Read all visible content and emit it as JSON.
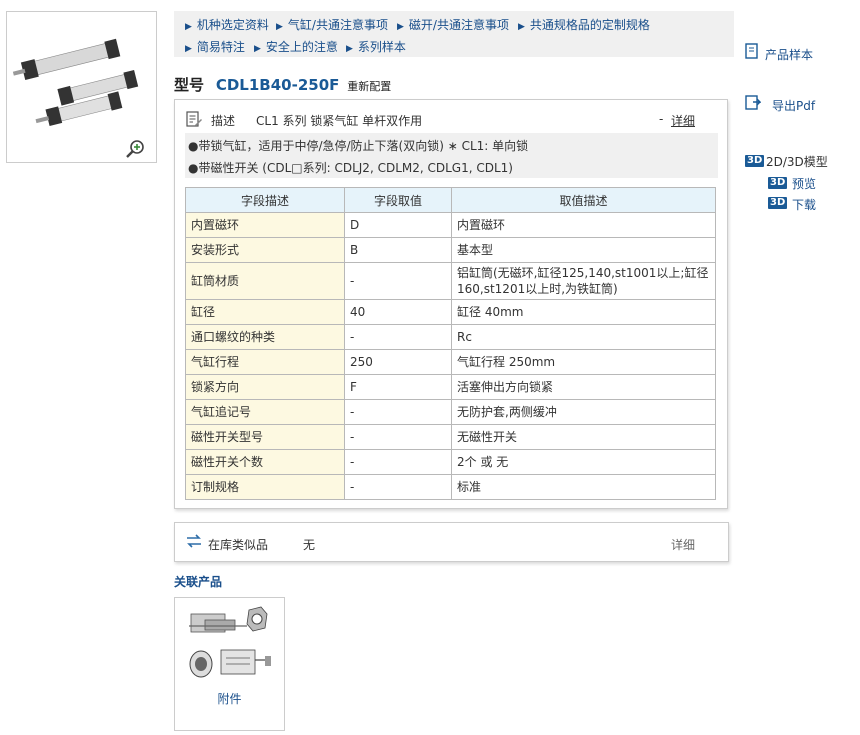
{
  "nav": {
    "row1": [
      "机种选定资料",
      "气缸/共通注意事项",
      "磁开/共通注意事项",
      "共通规格品的定制规格"
    ],
    "row2": [
      "简易特注",
      "安全上的注意",
      "系列样本"
    ]
  },
  "model": {
    "label": "型号",
    "code": "CDL1B40-250F",
    "reconfig": "重新配置"
  },
  "description": {
    "label": "描述",
    "text": "CL1 系列 锁紧气缸 单杆双作用",
    "dash": "-",
    "detail_link": "详细",
    "notes": [
      "●带锁气缸，适用于中停/急停/防止下落(双向锁) ∗ CL1: 单向锁",
      "●带磁性开关 (CDL□系列: CDLJ2, CDLM2, CDLG1, CDL1)"
    ]
  },
  "spec_table": {
    "headers": [
      "字段描述",
      "字段取值",
      "取值描述"
    ],
    "rows": [
      [
        "内置磁环",
        "D",
        "内置磁环"
      ],
      [
        "安装形式",
        "B",
        "基本型"
      ],
      [
        "缸筒材质",
        "-",
        "铝缸筒(无磁环,缸径125,140,st1001以上;缸径160,st1201以上时,为铁缸筒)"
      ],
      [
        "缸径",
        "40",
        "缸径 40mm"
      ],
      [
        "通口螺纹的种类",
        "-",
        "Rc"
      ],
      [
        "气缸行程",
        "250",
        "气缸行程 250mm"
      ],
      [
        "锁紧方向",
        "F",
        "活塞伸出方向锁紧"
      ],
      [
        "气缸追记号",
        "-",
        "无防护套,两侧缓冲"
      ],
      [
        "磁性开关型号",
        "-",
        "无磁性开关"
      ],
      [
        "磁性开关个数",
        "-",
        "2个 或 无"
      ],
      [
        "订制规格",
        "-",
        "标准"
      ]
    ]
  },
  "similar": {
    "label": "在库类似品",
    "value": "无",
    "detail_link": "详细"
  },
  "related": {
    "title": "关联产品",
    "accessory_label": "附件"
  },
  "sidebar": {
    "catalog": "产品样本",
    "export_pdf": "导出Pdf",
    "model_2d3d": "2D/3D模型",
    "badge": "3D",
    "preview": "预览",
    "download": "下载"
  },
  "colors": {
    "link": "#1a4f8b",
    "accent": "#1a5a96",
    "table_header_bg": "#e6f3fa",
    "first_col_bg": "#fdf9e1"
  }
}
